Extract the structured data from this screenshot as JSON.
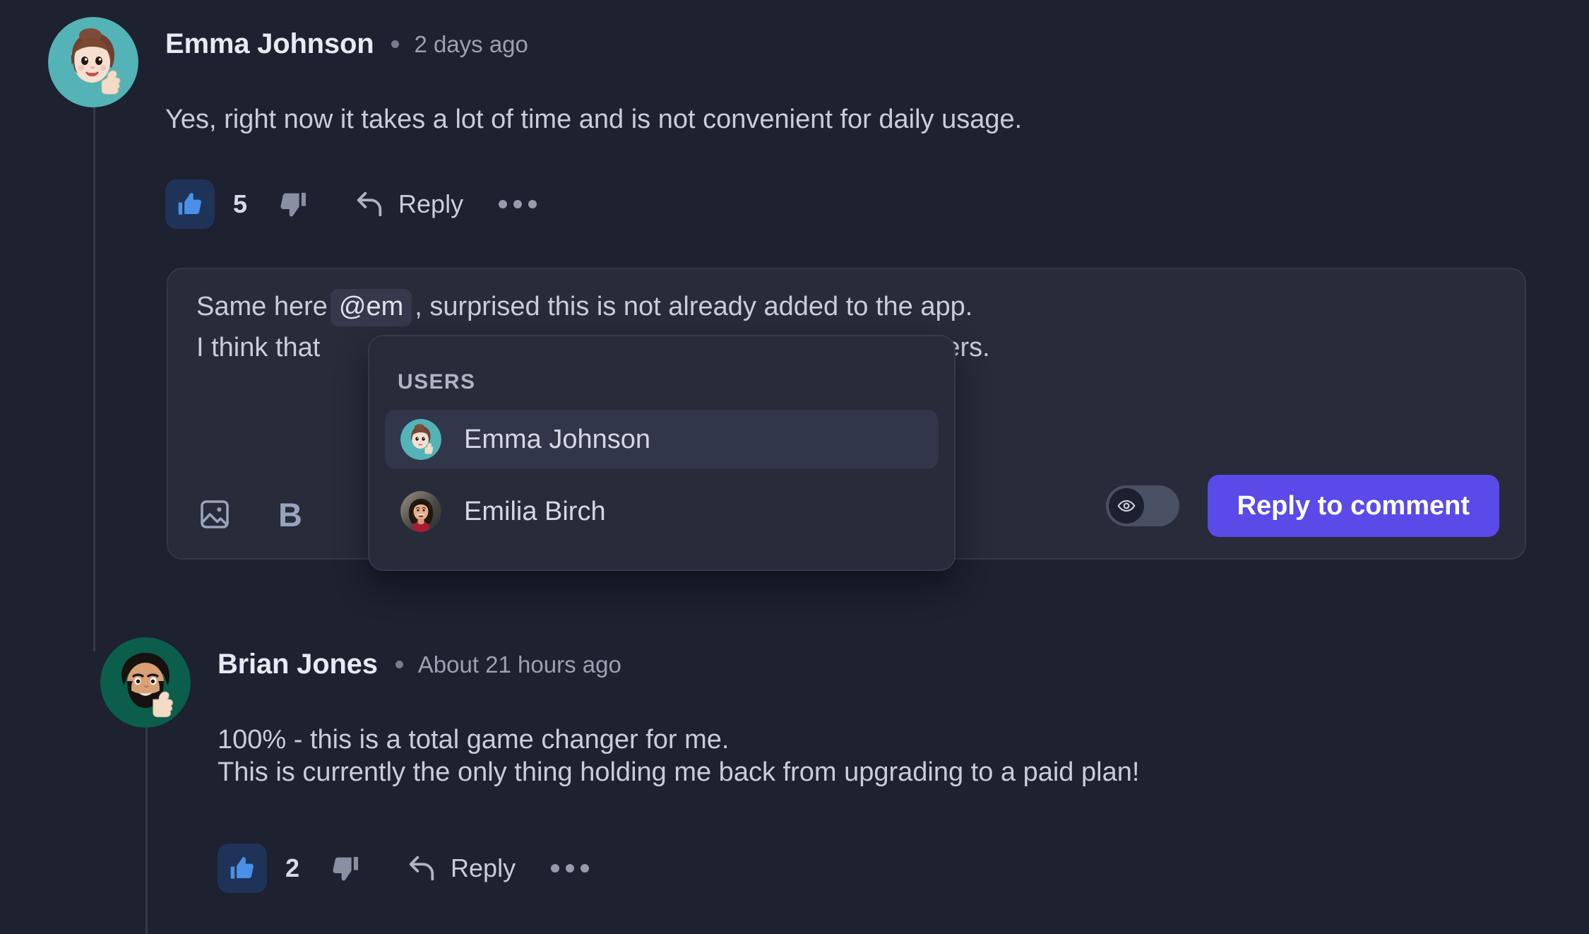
{
  "theme": {
    "page_bg": "#1d2130",
    "surface_bg": "#272b3a",
    "surface_border": "#333849",
    "selected_bg": "#31364a",
    "accent_primary": "#5a4ae8",
    "like_active": "#4a90e8",
    "like_chip_bg": "#1f3358",
    "text_primary": "#e8eaf2",
    "text_body": "#c8cdd9",
    "text_muted": "#9aa1b1"
  },
  "comments": [
    {
      "author": "Emma Johnson",
      "timestamp": "2 days ago",
      "body": "Yes, right now it takes a lot of time and is not convenient for daily usage.",
      "avatar_name": "avatar-emma-johnson",
      "avatar_bg": "#54b3b6",
      "like_count": "5",
      "reply_label": "Reply",
      "more_label": "…"
    },
    {
      "author": "Brian Jones",
      "timestamp": "About 21 hours ago",
      "body": "100% - this is a total game changer for me.\nThis is currently the only thing holding me back from upgrading to a paid plan!",
      "avatar_name": "avatar-brian-jones",
      "avatar_bg": "#0b5e4b",
      "like_count": "2",
      "reply_label": "Reply",
      "more_label": "…"
    }
  ],
  "editor": {
    "line1_before": "Same here",
    "mention_chip": "@em",
    "line1_after": ", surprised this is not already added to the app.",
    "line2_before": "I think that",
    "line2_after": "for users.",
    "toolbar": {
      "image_icon": "image-icon",
      "bold_icon": "B"
    },
    "visibility_toggle": {
      "icon": "eye-icon",
      "state": "off"
    },
    "submit_label": "Reply to comment"
  },
  "mention_dropdown": {
    "heading": "USERS",
    "items": [
      {
        "name": "Emma Johnson",
        "selected": true,
        "avatar_name": "avatar-emma-johnson",
        "avatar_bg": "#54b3b6"
      },
      {
        "name": "Emilia Birch",
        "selected": false,
        "avatar_name": "avatar-emilia-birch",
        "avatar_bg": "#6b6257"
      }
    ]
  }
}
